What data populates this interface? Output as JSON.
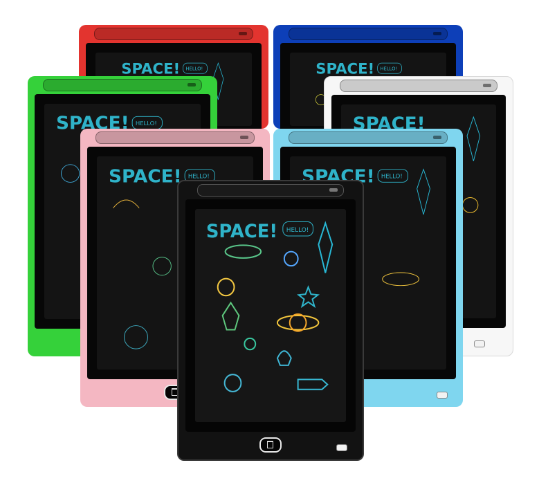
{
  "screen": {
    "title": "SPACE!",
    "bubble": "HELLO!"
  },
  "tablets": [
    {
      "id": "red",
      "color": "#e3342f"
    },
    {
      "id": "blue",
      "color": "#0d3fb8"
    },
    {
      "id": "green",
      "color": "#35d13a"
    },
    {
      "id": "white",
      "color": "#f7f7f7"
    },
    {
      "id": "pink",
      "color": "#f4b7c2"
    },
    {
      "id": "cyan",
      "color": "#7fd6ef"
    },
    {
      "id": "black",
      "color": "#121212"
    }
  ],
  "icons": [
    "trash-icon",
    "lock-icon",
    "rocket-icon",
    "planet-icon",
    "star-icon"
  ]
}
